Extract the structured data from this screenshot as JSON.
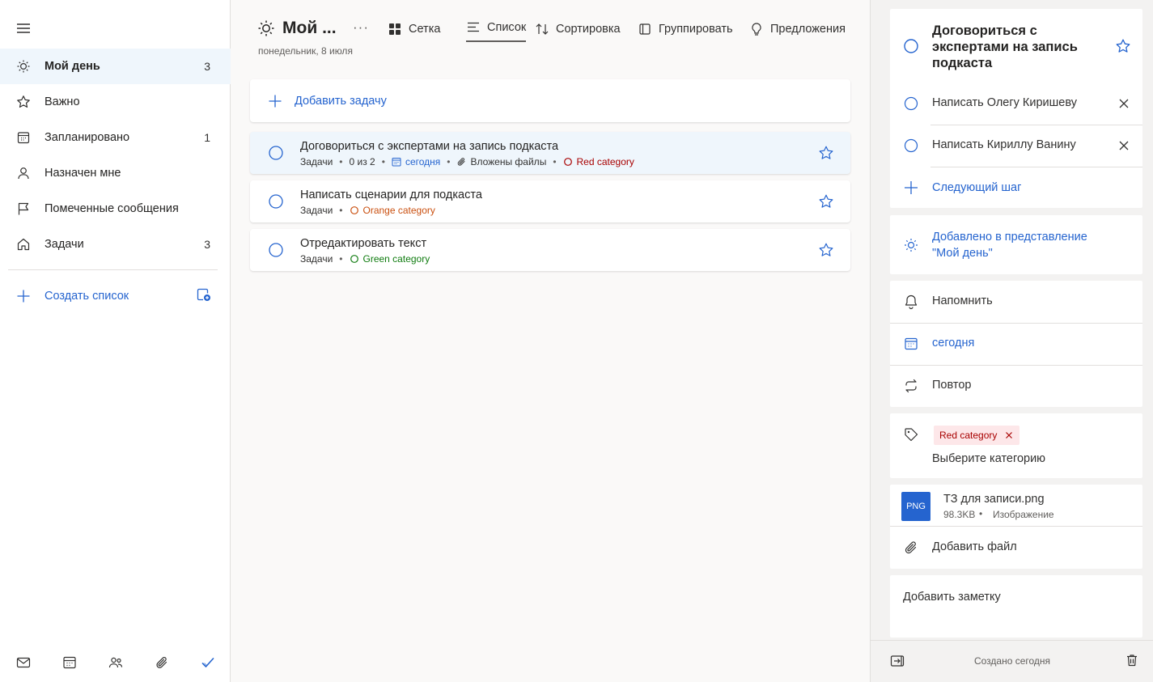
{
  "sidebar": {
    "items": [
      {
        "label": "Мой день",
        "count": "3",
        "icon": "sun-icon"
      },
      {
        "label": "Важно",
        "count": "",
        "icon": "star-icon"
      },
      {
        "label": "Запланировано",
        "count": "1",
        "icon": "calendar-icon"
      },
      {
        "label": "Назначен мне",
        "count": "",
        "icon": "person-icon"
      },
      {
        "label": "Помеченные сообщения",
        "count": "",
        "icon": "flag-icon"
      },
      {
        "label": "Задачи",
        "count": "3",
        "icon": "home-icon"
      }
    ],
    "create_list": "Создать список",
    "bottom_icons": [
      "mail-icon",
      "calendar-icon",
      "people-icon",
      "attachment-icon",
      "todo-check-icon"
    ]
  },
  "main": {
    "title": "Мой ...",
    "date": "понедельник, 8 июля",
    "toolbar": {
      "grid": "Сетка",
      "list": "Список",
      "sort": "Сортировка",
      "group": "Группировать",
      "suggestions": "Предложения"
    },
    "add_task": "Добавить задачу",
    "tasks": [
      {
        "title": "Договориться с экспертами на запись подкаста",
        "list": "Задачи",
        "steps": "0 из 2",
        "due": "сегодня",
        "files": "Вложены файлы",
        "category": "Red category",
        "selected": true
      },
      {
        "title": "Написать сценарии для подкаста",
        "list": "Задачи",
        "category": "Orange category"
      },
      {
        "title": "Отредактировать текст",
        "list": "Задачи",
        "category": "Green category"
      }
    ]
  },
  "details": {
    "title": "Договориться с экспертами на запись подкаста",
    "steps": [
      "Написать Олегу Киришеву",
      "Написать Кириллу Ванину"
    ],
    "next_step": "Следующий шаг",
    "my_day": "Добавлено в представление \"Мой день\"",
    "remind": "Напомнить",
    "due": "сегодня",
    "repeat": "Повтор",
    "category_tag": "Red category",
    "pick_category": "Выберите категорию",
    "file": {
      "badge": "PNG",
      "name": "ТЗ для записи.png",
      "size": "98.3KB",
      "type": "Изображение"
    },
    "add_file": "Добавить файл",
    "note_placeholder": "Добавить заметку",
    "created": "Создано сегодня"
  },
  "colors": {
    "accent": "#2564cf",
    "red": "#a80000",
    "orange": "#ca5010",
    "green": "#107c10"
  }
}
